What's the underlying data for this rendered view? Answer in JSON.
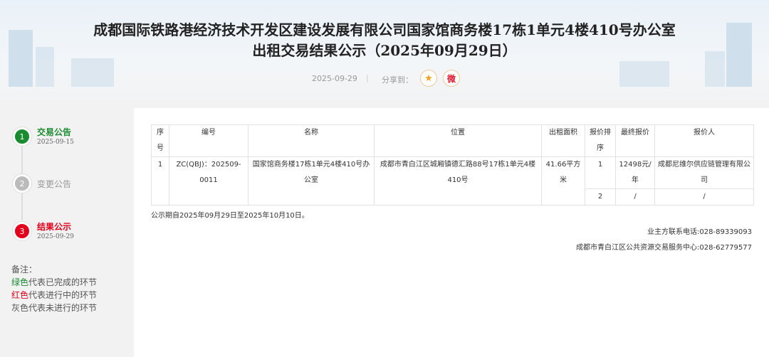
{
  "header": {
    "title_line1": "成都国际铁路港经济技术开发区建设发展有限公司国家馆商务楼17栋1单元4楼410号办公室",
    "title_line2": "出租交易结果公示（2025年09月29日）",
    "date": "2025-09-29",
    "separator": "|",
    "share_label": "分享到：",
    "share_icons": [
      "qzone-star-icon",
      "weibo-icon"
    ]
  },
  "steps": [
    {
      "number": "1",
      "label": "交易公告",
      "date": "2025-09-15",
      "status": "completed",
      "color": "#1a8b2e"
    },
    {
      "number": "2",
      "label": "变更公告",
      "date": "",
      "status": "pending",
      "color": "#bbbbbb"
    },
    {
      "number": "3",
      "label": "结果公示",
      "date": "2025-09-29",
      "status": "current",
      "color": "#e3001b"
    }
  ],
  "notes": {
    "title": "备注：",
    "green_word": "绿色",
    "green_rest": "代表已完成的环节",
    "red_word": "红色",
    "red_rest": "代表进行中的环节",
    "gray_line": "灰色代表未进行的环节"
  },
  "table": {
    "headers": [
      "序号",
      "编号",
      "名称",
      "位置",
      "出租面积",
      "报价排序",
      "最终报价",
      "报价人"
    ],
    "row": {
      "index": "1",
      "code": "ZC(QBJ)：202509-0011",
      "name": "国家馆商务楼17栋1单元4楼410号办公室",
      "location": "成都市青白江区城厢镇德汇路88号17栋1单元4楼410号",
      "area": "41.66平方米",
      "bids": [
        {
          "rank": "1",
          "price": "12498元/年",
          "bidder": "成都尼维尔供应链管理有限公司"
        },
        {
          "rank": "2",
          "price": "/",
          "bidder": "/"
        }
      ]
    }
  },
  "footer": {
    "notice": "公示期自2025年09月29日至2025年10月10日。",
    "contact_owner": "业主方联系电话:028-89339093",
    "contact_center": "成都市青白江区公共资源交易服务中心:028-62779577"
  }
}
